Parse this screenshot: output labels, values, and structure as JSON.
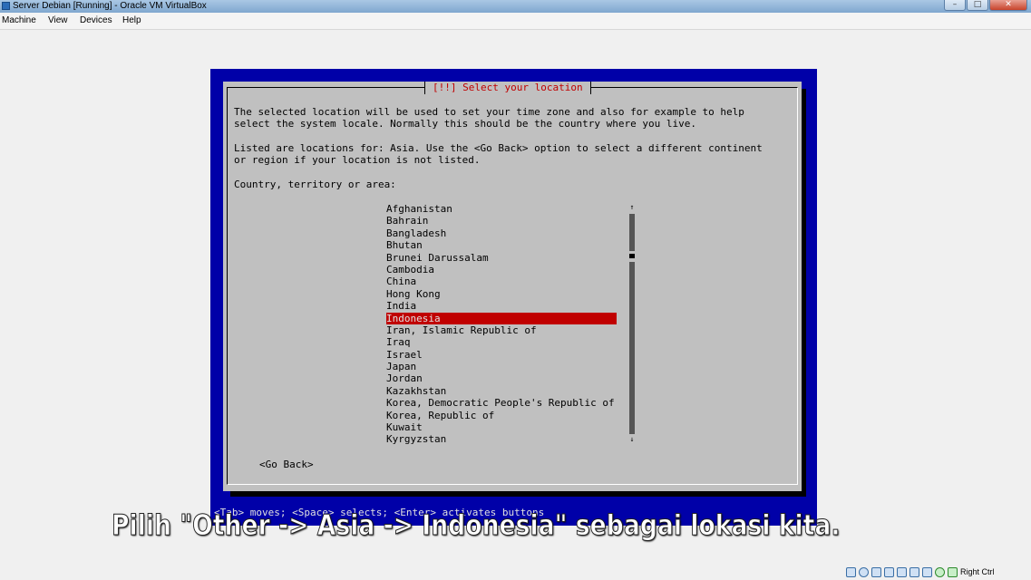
{
  "window": {
    "title": "Server Debian [Running] - Oracle VM VirtualBox",
    "controls": {
      "minimize": "–",
      "maximize": "□",
      "close": "✕"
    }
  },
  "menu": [
    "Machine",
    "View",
    "Devices",
    "Help"
  ],
  "dialog": {
    "title": "[!!] Select your location",
    "paragraph1_line1": "The selected location will be used to set your time zone and also for example to help",
    "paragraph1_line2": "select the system locale. Normally this should be the country where you live.",
    "paragraph2_line1": "Listed are locations for: Asia. Use the <Go Back> option to select a different continent",
    "paragraph2_line2": "or region if your location is not listed.",
    "prompt": "Country, territory or area:",
    "countries": [
      "Afghanistan",
      "Bahrain",
      "Bangladesh",
      "Bhutan",
      "Brunei Darussalam",
      "Cambodia",
      "China",
      "Hong Kong",
      "India",
      "Indonesia",
      "Iran, Islamic Republic of",
      "Iraq",
      "Israel",
      "Japan",
      "Jordan",
      "Kazakhstan",
      "Korea, Democratic People's Republic of",
      "Korea, Republic of",
      "Kuwait",
      "Kyrgyzstan"
    ],
    "selected": "Indonesia",
    "scroll_up": "↑",
    "scroll_down": "↓",
    "go_back": "<Go Back>"
  },
  "statusline": "<Tab> moves; <Space> selects; <Enter> activates buttons",
  "subtitle": "Pilih \"Other -> Asia -> Indonesia\" sebagai lokasi kita.",
  "tray": {
    "host_key": "Right Ctrl"
  },
  "colors": {
    "vm_blue": "#0000a8",
    "dialog_gray": "#c0c0c0",
    "highlight": "#c00000"
  }
}
